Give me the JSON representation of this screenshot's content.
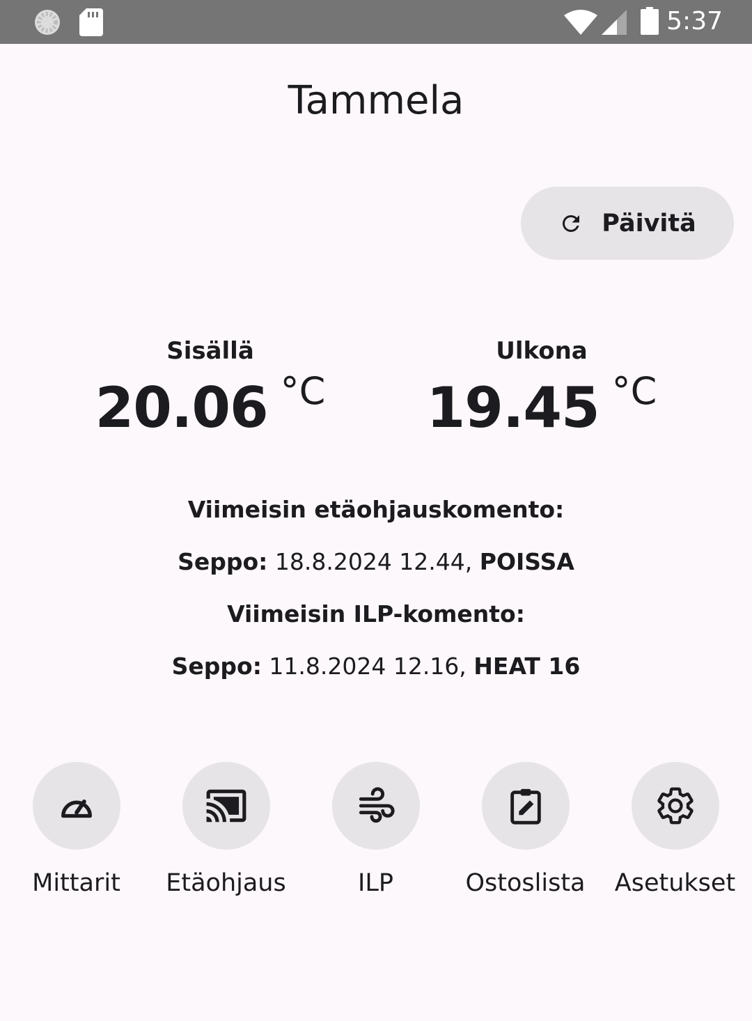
{
  "status_bar": {
    "time": "5:37",
    "icons": [
      "sync-icon",
      "sd-card-icon",
      "wifi-icon",
      "cell-signal-icon",
      "battery-icon"
    ]
  },
  "app": {
    "title": "Tammela"
  },
  "refresh": {
    "label": "Päivitä",
    "icon": "refresh-icon"
  },
  "temperatures": {
    "inside": {
      "label": "Sisällä",
      "value": "20.06",
      "unit": "°C"
    },
    "outside": {
      "label": "Ulkona",
      "value": "19.45",
      "unit": "°C"
    }
  },
  "commands": {
    "remote_heading": "Viimeisin etäohjauskomento:",
    "remote": {
      "user": "Seppo:",
      "time": " 18.8.2024 12.44,",
      "action": "POISSA"
    },
    "ilp_heading": "Viimeisin ILP-komento:",
    "ilp": {
      "user": "Seppo:",
      "time": " 11.8.2024 12.16,",
      "action": "HEAT 16"
    }
  },
  "nav": {
    "items": [
      {
        "label": "Mittarit",
        "icon": "speedometer-icon"
      },
      {
        "label": "Etäohjaus",
        "icon": "cast-icon"
      },
      {
        "label": "ILP",
        "icon": "air-icon"
      },
      {
        "label": "Ostoslista",
        "icon": "clipboard-edit-icon"
      },
      {
        "label": "Asetukset",
        "icon": "gear-icon"
      }
    ]
  },
  "colors": {
    "background": "#fdf8fb",
    "status_bar": "#757575",
    "button_surface": "#e6e4e6",
    "text": "#1c1b1f"
  }
}
